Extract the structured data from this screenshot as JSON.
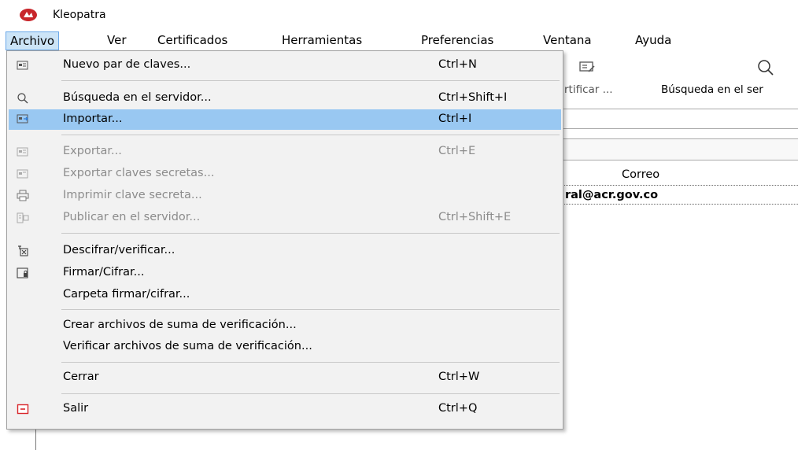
{
  "window": {
    "title": "Kleopatra",
    "icon": "kleopatra-icon"
  },
  "menubar": {
    "items": [
      "Archivo",
      "Ver",
      "Certificados",
      "Herramientas",
      "Preferencias",
      "Ventana",
      "Ayuda"
    ],
    "active": "Archivo"
  },
  "toolbar": {
    "certificar_label": "rtificar ...",
    "busqueda_label": "Búsqueda en el ser"
  },
  "table": {
    "column_correo": "Correo",
    "email_cell": "ral@acr.gov.co"
  },
  "archivo_menu": {
    "items": [
      {
        "label": "Nuevo par de claves...",
        "shortcut": "Ctrl+N",
        "icon": "new-keypair-icon",
        "enabled": true
      },
      {
        "label": "Búsqueda en el servidor...",
        "shortcut": "Ctrl+Shift+I",
        "icon": "search-icon",
        "enabled": true
      },
      {
        "label": "Importar...",
        "shortcut": "Ctrl+I",
        "icon": "import-icon",
        "enabled": true,
        "highlighted": true
      },
      {
        "label": "Exportar...",
        "shortcut": "Ctrl+E",
        "icon": "export-icon",
        "enabled": false
      },
      {
        "label": "Exportar claves secretas...",
        "shortcut": "",
        "icon": "export-secret-icon",
        "enabled": false
      },
      {
        "label": "Imprimir clave secreta...",
        "shortcut": "",
        "icon": "printer-icon",
        "enabled": false
      },
      {
        "label": "Publicar en el servidor...",
        "shortcut": "Ctrl+Shift+E",
        "icon": "publish-icon",
        "enabled": false
      },
      {
        "label": "Descifrar/verificar...",
        "shortcut": "",
        "icon": "decrypt-verify-icon",
        "enabled": true
      },
      {
        "label": "Firmar/Cifrar...",
        "shortcut": "",
        "icon": "sign-encrypt-icon",
        "enabled": true
      },
      {
        "label": "Carpeta firmar/cifrar...",
        "shortcut": "",
        "icon": "",
        "enabled": true
      },
      {
        "label": "Crear archivos de suma de verificación...",
        "shortcut": "",
        "icon": "",
        "enabled": true
      },
      {
        "label": "Verificar archivos de suma de verificación...",
        "shortcut": "",
        "icon": "",
        "enabled": true
      },
      {
        "label": "Cerrar",
        "shortcut": "Ctrl+W",
        "icon": "",
        "enabled": true
      },
      {
        "label": "Salir",
        "shortcut": "Ctrl+Q",
        "icon": "exit-icon",
        "enabled": true
      }
    ]
  },
  "colors": {
    "highlight": "#99c8f2",
    "menubar_active": "#cce4f7",
    "exit_icon": "#d9262b"
  }
}
